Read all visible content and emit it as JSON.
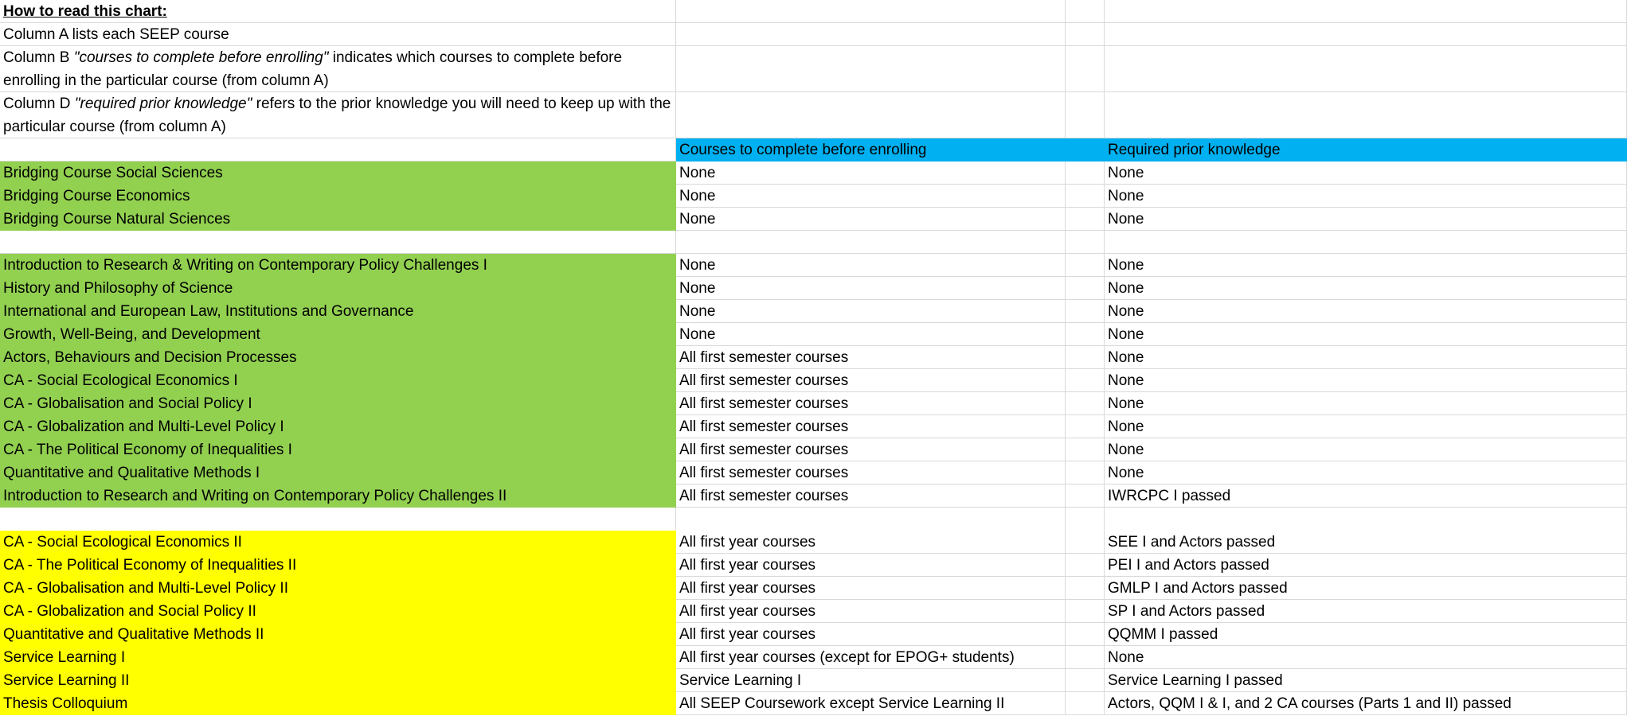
{
  "intro": {
    "heading": "How to read this chart:",
    "line1": "Column A lists each SEEP course",
    "line2_prefix": "Column B ",
    "line2_em": "\"courses to complete before enrolling\"",
    "line2_suffix": " indicates which courses to complete before enrolling in the particular course (from column A)",
    "line3_prefix": "Column D ",
    "line3_em": "\"required prior knowledge\"",
    "line3_suffix": " refers to the prior knowledge you will need to keep up with the particular course (from column A)"
  },
  "headers": {
    "col_b": "Courses to complete before enrolling",
    "col_d": "Required prior knowledge"
  },
  "bridging": [
    {
      "course": "Bridging Course Social Sciences",
      "before": "None",
      "prior": "None"
    },
    {
      "course": "Bridging Course Economics",
      "before": "None",
      "prior": "None"
    },
    {
      "course": "Bridging Course Natural Sciences",
      "before": "None",
      "prior": "None"
    }
  ],
  "first_year": [
    {
      "course": "Introduction to Research & Writing on Contemporary Policy Challenges I",
      "before": "None",
      "prior": "None"
    },
    {
      "course": "History and Philosophy of Science",
      "before": "None",
      "prior": "None"
    },
    {
      "course": "International and European Law, Institutions and Governance",
      "before": "None",
      "prior": "None"
    },
    {
      "course": "Growth, Well-Being, and Development",
      "before": "None",
      "prior": "None"
    },
    {
      "course": "Actors, Behaviours and Decision Processes",
      "before": "All first semester courses",
      "prior": "None"
    },
    {
      "course": "CA - Social Ecological Economics I",
      "before": "All first semester courses",
      "prior": "None"
    },
    {
      "course": "CA - Globalisation and Social Policy I",
      "before": "All first semester courses",
      "prior": "None"
    },
    {
      "course": "CA - Globalization and Multi-Level Policy I",
      "before": "All first semester courses",
      "prior": "None"
    },
    {
      "course": "CA - The Political Economy of Inequalities I",
      "before": "All first semester courses",
      "prior": "None"
    },
    {
      "course": "Quantitative and Qualitative Methods I",
      "before": "All first semester courses",
      "prior": "None"
    },
    {
      "course": "Introduction to Research and Writing on Contemporary Policy Challenges II",
      "before": "All first semester courses",
      "prior": "IWRCPC I passed"
    }
  ],
  "second_year": [
    {
      "course": "CA - Social Ecological Economics II",
      "before": "All first year courses",
      "prior": "SEE I and Actors passed"
    },
    {
      "course": "CA - The Political Economy of Inequalities II",
      "before": "All first year courses",
      "prior": "PEI I and Actors passed"
    },
    {
      "course": "CA - Globalisation and Multi-Level Policy II",
      "before": "All first year courses",
      "prior": "GMLP I and Actors passed"
    },
    {
      "course": "CA - Globalization and Social Policy II",
      "before": "All first year courses",
      "prior": "SP I and Actors passed"
    },
    {
      "course": "Quantitative and Qualitative Methods II",
      "before": "All first year courses",
      "prior": "QQMM I passed"
    },
    {
      "course": "Service Learning I",
      "before": "All first year courses (except for EPOG+ students)",
      "prior": "None"
    },
    {
      "course": "Service Learning II",
      "before": "Service Learning I",
      "prior": "Service Learning I passed"
    },
    {
      "course": "Thesis Colloquium",
      "before": "All SEEP Coursework except Service Learning II",
      "prior": "Actors, QQM I & I, and 2 CA courses (Parts 1 and II) passed"
    }
  ],
  "colors": {
    "bridging_first_year": "#92d050",
    "second_year": "#ffff00",
    "header": "#00b0f0",
    "gridline": "#d9d9d9"
  }
}
